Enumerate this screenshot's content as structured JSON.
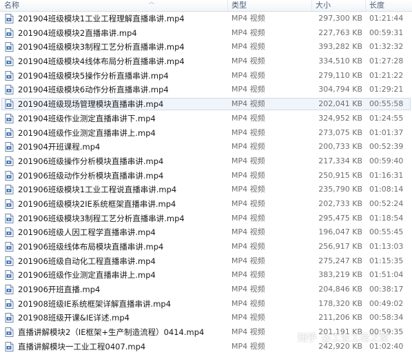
{
  "columns": {
    "name": "名称",
    "type": "类型",
    "size": "大小",
    "duration": "长度"
  },
  "files": [
    {
      "name": "201904班级模块1工业工程理解直播串讲.mp4",
      "type": "MP4 视频",
      "size": "297,300 KB",
      "duration": "01:21:44"
    },
    {
      "name": "201904班级模块2直播串讲.mp4",
      "type": "MP4 视频",
      "size": "227,763 KB",
      "duration": "00:59:31"
    },
    {
      "name": "201904班级模块3制程工艺分析直播串讲.mp4",
      "type": "MP4 视频",
      "size": "393,282 KB",
      "duration": "01:32:32"
    },
    {
      "name": "201904班级模块4线体布局分析直播串讲.mp4",
      "type": "MP4 视频",
      "size": "334,510 KB",
      "duration": "01:27:28"
    },
    {
      "name": "201904班级模块5操作分析直播串讲.mp4",
      "type": "MP4 视频",
      "size": "279,110 KB",
      "duration": "01:21:22"
    },
    {
      "name": "201904班级模块6动作分析直播串讲.mp4",
      "type": "MP4 视频",
      "size": "304,794 KB",
      "duration": "01:29:21"
    },
    {
      "name": "201904班级现场管理模块直播串讲.mp4",
      "type": "MP4 视频",
      "size": "202,041 KB",
      "duration": "00:55:58",
      "selected": true
    },
    {
      "name": "201904班级作业测定直播串讲下.mp4",
      "type": "MP4 视频",
      "size": "324,952 KB",
      "duration": "01:24:55"
    },
    {
      "name": "201904班级作业测定直播串讲上.mp4",
      "type": "MP4 视频",
      "size": "273,075 KB",
      "duration": "01:01:37"
    },
    {
      "name": "201904开班课程.mp4",
      "type": "MP4 视频",
      "size": "200,733 KB",
      "duration": "00:52:39"
    },
    {
      "name": "201906班级操作分析模块直播串讲.mp4",
      "type": "MP4 视频",
      "size": "217,334 KB",
      "duration": "00:59:40"
    },
    {
      "name": "201906班级动作分析模块直播串讲.mp4",
      "type": "MP4 视频",
      "size": "250,915 KB",
      "duration": "01:16:31"
    },
    {
      "name": "201906班级模块1工业工程说直播串讲.mp4",
      "type": "MP4 视频",
      "size": "235,790 KB",
      "duration": "01:08:14"
    },
    {
      "name": "201906班级模块2IE系统框架直播串讲.mp4",
      "type": "MP4 视频",
      "size": "202,733 KB",
      "duration": "00:52:24"
    },
    {
      "name": "201906班级模块3制程工艺分析直播串讲.mp4",
      "type": "MP4 视频",
      "size": "295,475 KB",
      "duration": "01:18:54"
    },
    {
      "name": "201906班级人因工程学直播串讲.mp4",
      "type": "MP4 视频",
      "size": "196,047 KB",
      "duration": "00:55:45"
    },
    {
      "name": "201906班级线体布局模块直播串讲.mp4",
      "type": "MP4 视频",
      "size": "256,917 KB",
      "duration": "01:13:03"
    },
    {
      "name": "201906班级自动化工程直播串讲.mp4",
      "type": "MP4 视频",
      "size": "275,247 KB",
      "duration": "01:15:35"
    },
    {
      "name": "201906班级作业测定直播串讲上.mp4",
      "type": "MP4 视频",
      "size": "383,219 KB",
      "duration": "01:51:04"
    },
    {
      "name": "201906开班直播.mp4",
      "type": "MP4 视频",
      "size": "204,846 KB",
      "duration": "00:38:17"
    },
    {
      "name": "201908班级IE系统框架详解直播串讲.mp4",
      "type": "MP4 视频",
      "size": "178,320 KB",
      "duration": "00:49:02"
    },
    {
      "name": "201908班级开课&IE详述.mp4",
      "type": "MP4 视频",
      "size": "211,206 KB",
      "duration": "00:58:34"
    },
    {
      "name": "直播讲解模块2（IE框架+生产制造流程）0414.mp4",
      "type": "MP4 视频",
      "size": "201,191 KB",
      "duration": "00:59:35"
    },
    {
      "name": "直播讲解模块一工业工程0407.mp4",
      "type": "MP4 视频",
      "size": "242,920 KB",
      "duration": "01:02:40"
    }
  ],
  "icon": "mp4-file-icon",
  "watermark": {
    "logo": "知乎",
    "text": "@工业工程之家"
  }
}
